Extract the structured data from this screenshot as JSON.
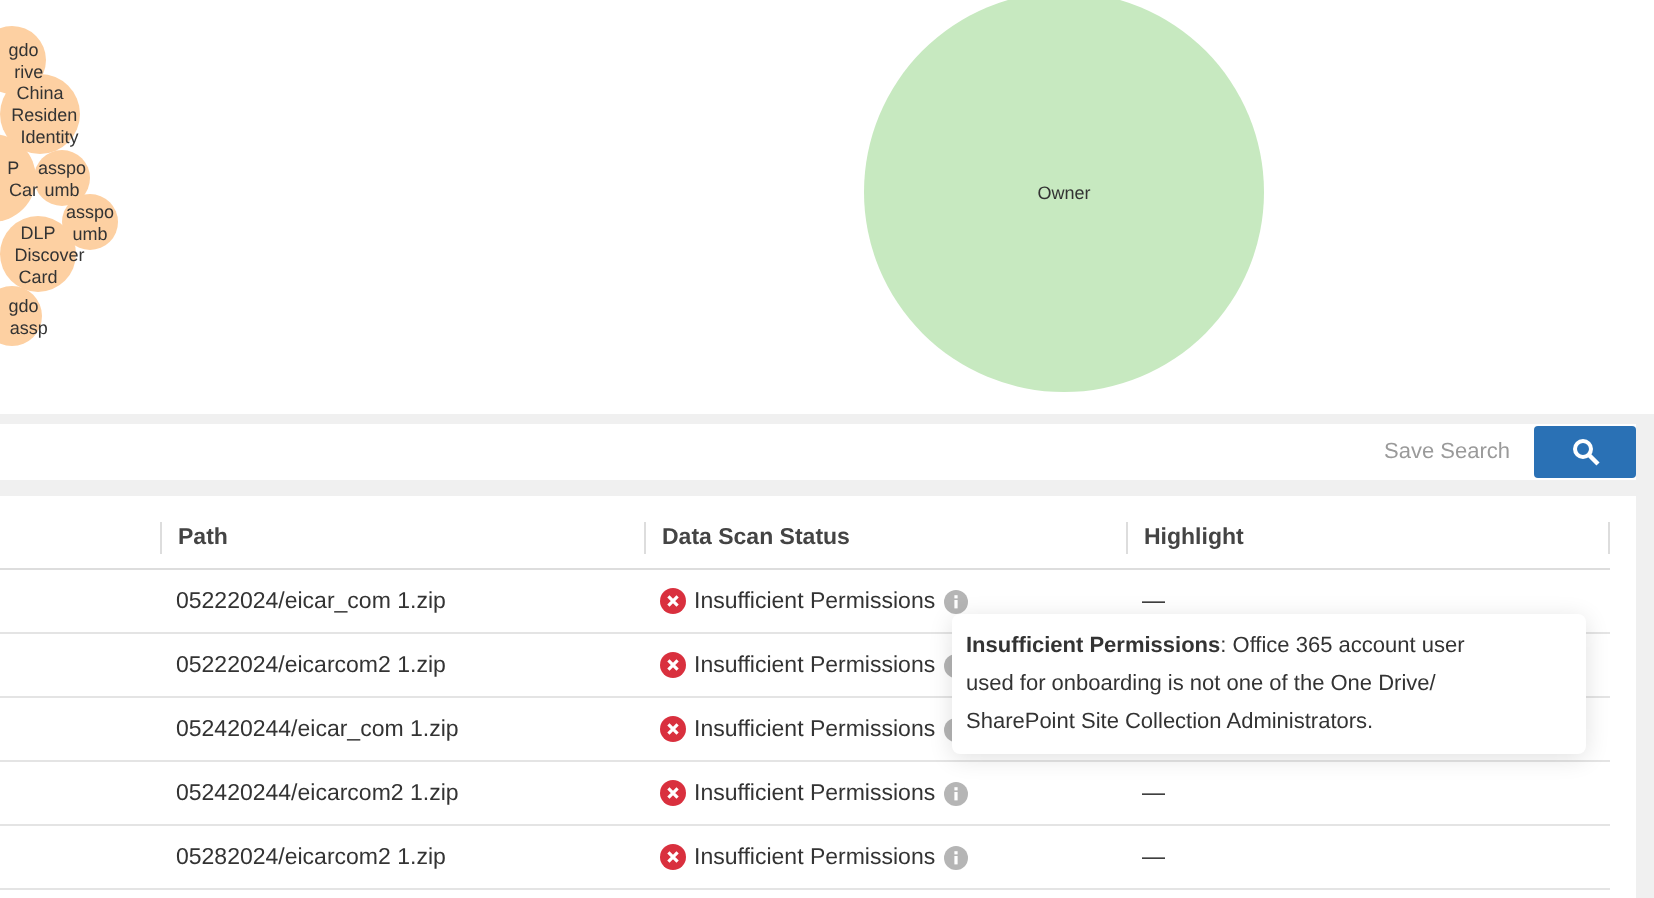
{
  "bubble_chart": {
    "bubbles": [
      {
        "lines": [
          "gdo",
          "rive"
        ],
        "kind": "category"
      },
      {
        "lines": [
          "China",
          "Residen",
          "Identity"
        ],
        "kind": "category"
      },
      {
        "lines": [
          "P",
          "Car"
        ],
        "kind": "category"
      },
      {
        "lines": [
          "asspo",
          "umb"
        ],
        "kind": "category"
      },
      {
        "lines": [
          "asspo",
          "umb"
        ],
        "kind": "category"
      },
      {
        "lines": [
          "DLP",
          "Discover",
          "Card"
        ],
        "kind": "category"
      },
      {
        "lines": [
          "gdo",
          "assp"
        ],
        "kind": "category"
      },
      {
        "lines": [
          "Owner"
        ],
        "kind": "owner"
      }
    ]
  },
  "search": {
    "save_label": "Save Search"
  },
  "table": {
    "columns": [
      "Path",
      "Data Scan Status",
      "Highlight"
    ],
    "rows": [
      {
        "path": "05222024/eicar_com 1.zip",
        "status": "Insufficient Permissions",
        "highlight": "—"
      },
      {
        "path": "05222024/eicarcom2 1.zip",
        "status": "Insufficient Permissions"
      },
      {
        "path": "052420244/eicar_com 1.zip",
        "status": "Insufficient Permissions"
      },
      {
        "path": "052420244/eicarcom2 1.zip",
        "status": "Insufficient Permissions",
        "highlight": "—"
      },
      {
        "path": "05282024/eicarcom2 1.zip",
        "status": "Insufficient Permissions",
        "highlight": "—"
      }
    ]
  },
  "tooltip": {
    "text": "**Insufficient Permissions**: Office 365 account user used for onboarding is not one of the One Drive/ SharePoint Site Collection Administrators."
  }
}
